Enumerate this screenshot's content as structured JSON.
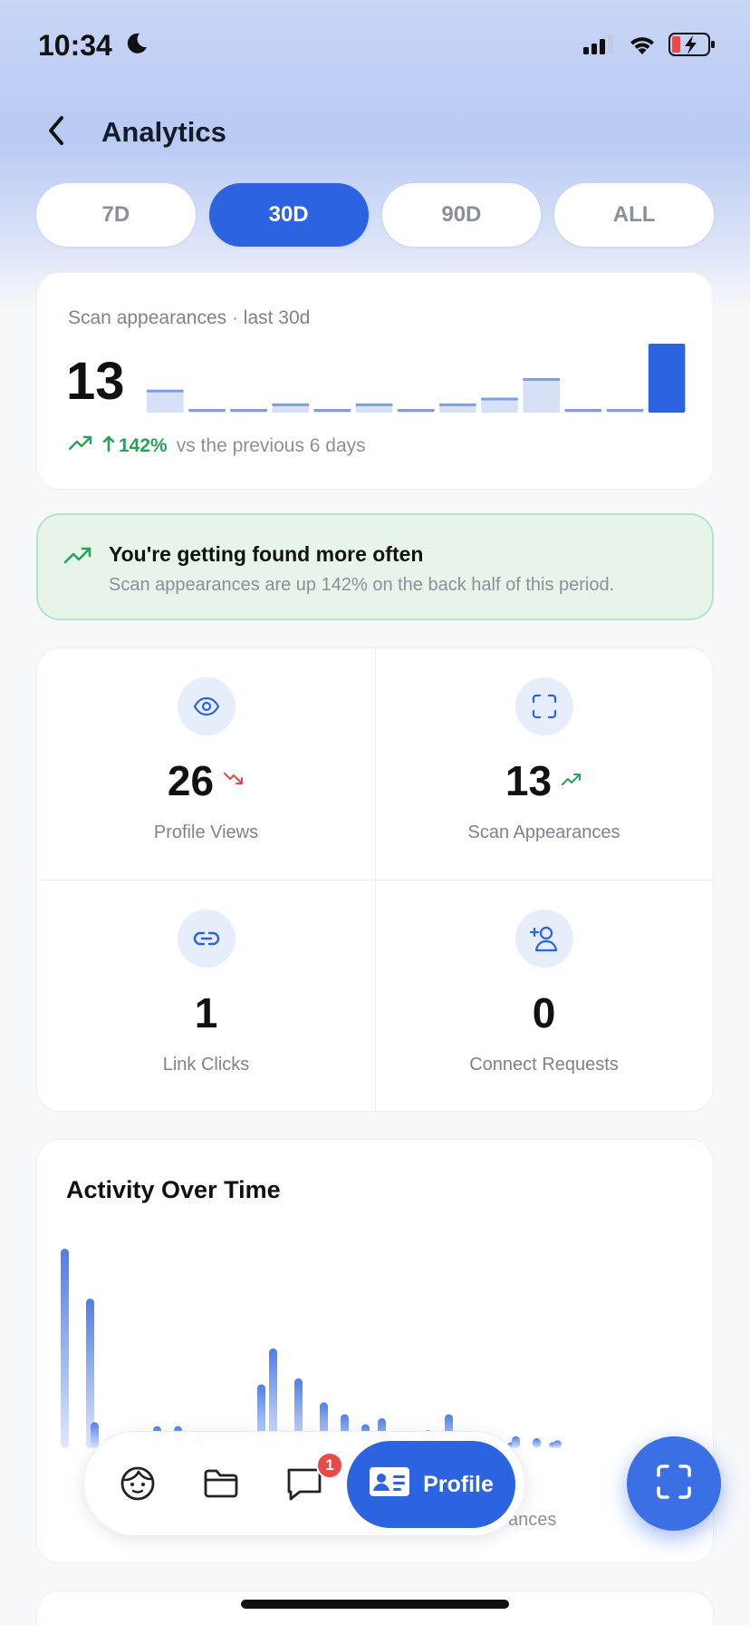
{
  "status_bar": {
    "time": "10:34",
    "icons": [
      "moon-icon",
      "signal-icon",
      "wifi-icon",
      "battery-charging-icon"
    ]
  },
  "header": {
    "title": "Analytics",
    "back_icon": "chevron-left-icon"
  },
  "range_tabs": [
    {
      "label": "7D",
      "active": false
    },
    {
      "label": "30D",
      "active": true
    },
    {
      "label": "90D",
      "active": false
    },
    {
      "label": "ALL",
      "active": false
    }
  ],
  "scan_summary": {
    "label": "Scan appearances · last 30d",
    "value": "13",
    "change_pct": "142%",
    "change_text": "vs the previous 6 days",
    "bars": [
      2,
      0.3,
      0.3,
      0.8,
      0.3,
      0.8,
      0.3,
      0.8,
      1.3,
      3,
      0.3,
      0.3,
      6
    ],
    "bar_highlight_index": 12
  },
  "insight": {
    "title": "You're getting found more often",
    "body": "Scan appearances are up 142% on the back half of this period."
  },
  "stats": [
    {
      "icon": "eye-icon",
      "value": "26",
      "trend": "down",
      "label": "Profile Views"
    },
    {
      "icon": "scan-frame-icon",
      "value": "13",
      "trend": "up",
      "label": "Scan Appearances"
    },
    {
      "icon": "link-icon",
      "value": "1",
      "trend": "none",
      "label": "Link Clicks"
    },
    {
      "icon": "add-person-icon",
      "value": "0",
      "trend": "none",
      "label": "Connect Requests"
    }
  ],
  "activity": {
    "title": "Activity Over Time",
    "legend_partial": "ances"
  },
  "chart_data": {
    "type": "bar",
    "title": "Activity Over Time",
    "series": [
      {
        "values": [
          10,
          0,
          0,
          0,
          0,
          0,
          0,
          0,
          0,
          0,
          5,
          0,
          0,
          0,
          0,
          0,
          0,
          0,
          0,
          0,
          0,
          0,
          0,
          0,
          0,
          0,
          0,
          0,
          0,
          0
        ]
      },
      {
        "values": [
          0,
          7.5,
          0,
          0,
          0,
          0,
          0,
          0,
          0,
          0,
          0,
          3.5,
          0,
          0,
          0,
          1.5,
          0,
          0,
          0,
          0,
          0,
          0,
          0,
          0,
          0,
          0,
          0,
          0,
          0,
          0
        ]
      },
      {
        "values": [
          0,
          1.3,
          0,
          0,
          1.1,
          1.1,
          0.6,
          0,
          0,
          3.2,
          0,
          0,
          2.3,
          1.7,
          1.2,
          0,
          0.5,
          0.9,
          1.7,
          0.8,
          0.4,
          0.3,
          0,
          0.3,
          0,
          0,
          0,
          0,
          0,
          0
        ]
      },
      {
        "values": [
          0,
          0,
          0,
          0,
          0,
          0,
          0,
          0,
          0,
          0,
          0,
          0,
          0,
          0,
          0,
          0,
          0,
          0,
          0,
          0,
          0,
          0.6,
          0.5,
          0.4,
          0,
          0,
          0,
          0,
          0,
          0
        ]
      }
    ]
  },
  "bottom_nav": {
    "items": [
      {
        "icon": "face-icon"
      },
      {
        "icon": "folder-icon"
      },
      {
        "icon": "chat-bubble-icon",
        "badge": "1"
      }
    ],
    "active_label": "Profile",
    "active_icon": "id-card-icon"
  },
  "fab": {
    "icon": "scan-frame-icon"
  },
  "colors": {
    "accent": "#2c63e0",
    "positive": "#2aa15a",
    "negative": "#e04848",
    "insight_bg": "#e7f4ea"
  }
}
